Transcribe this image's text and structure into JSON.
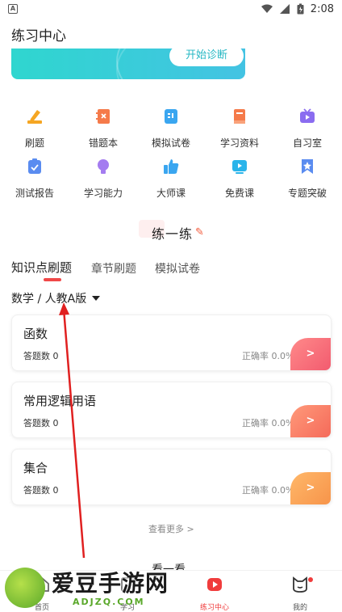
{
  "status_bar": {
    "time": "2:08",
    "left_icon": "A"
  },
  "header": {
    "title": "练习中心"
  },
  "banner": {
    "button_label": "开始诊断"
  },
  "grid": {
    "row1": [
      {
        "label": "刷题",
        "icon": "pencil-icon",
        "color": "#f5a623"
      },
      {
        "label": "错题本",
        "icon": "notebook-icon",
        "color": "#f57a4a"
      },
      {
        "label": "模拟试卷",
        "icon": "exam-paper-icon",
        "color": "#3aa6f0"
      },
      {
        "label": "学习资料",
        "icon": "book-icon",
        "color": "#f57a4a"
      },
      {
        "label": "自习室",
        "icon": "tv-icon",
        "color": "#8a6cf0"
      }
    ],
    "row2": [
      {
        "label": "测试报告",
        "icon": "report-icon",
        "color": "#5a8cf0"
      },
      {
        "label": "学习能力",
        "icon": "bulb-icon",
        "color": "#a47cf0"
      },
      {
        "label": "大师课",
        "icon": "thumb-up-icon",
        "color": "#3aa6f0"
      },
      {
        "label": "免费课",
        "icon": "play-screen-icon",
        "color": "#2ab4ea"
      },
      {
        "label": "专题突破",
        "icon": "bookmark-star-icon",
        "color": "#5a8cf0"
      }
    ]
  },
  "section": {
    "title": "练一练"
  },
  "tabs": [
    {
      "label": "知识点刷题",
      "active": true
    },
    {
      "label": "章节刷题",
      "active": false
    },
    {
      "label": "模拟试卷",
      "active": false
    }
  ],
  "subject": {
    "label": "数学 / 人教A版"
  },
  "cards": [
    {
      "title": "函数",
      "count": "答题数 0",
      "rate": "正确率 0.0%",
      "color": "#f25b6f",
      "arrow": ">"
    },
    {
      "title": "常用逻辑用语",
      "count": "答题数 0",
      "rate": "正确率 0.0%",
      "color": "#f56a5a",
      "arrow": ">"
    },
    {
      "title": "集合",
      "count": "答题数 0",
      "rate": "正确率 0.0%",
      "color": "#f7944a",
      "arrow": ">"
    }
  ],
  "more": {
    "label": "查看更多 >"
  },
  "bottom_partial": {
    "label": "看一看"
  },
  "tabbar": [
    {
      "label": "首页",
      "icon": "home-icon",
      "active": false
    },
    {
      "label": "学习",
      "icon": "book-icon",
      "active": false
    },
    {
      "label": "练习中心",
      "icon": "play-icon",
      "active": true
    },
    {
      "label": "我的",
      "icon": "cat-face-icon",
      "active": false
    }
  ],
  "watermark": {
    "title": "爱豆手游网",
    "subtitle": "ADJZQ.COM"
  }
}
